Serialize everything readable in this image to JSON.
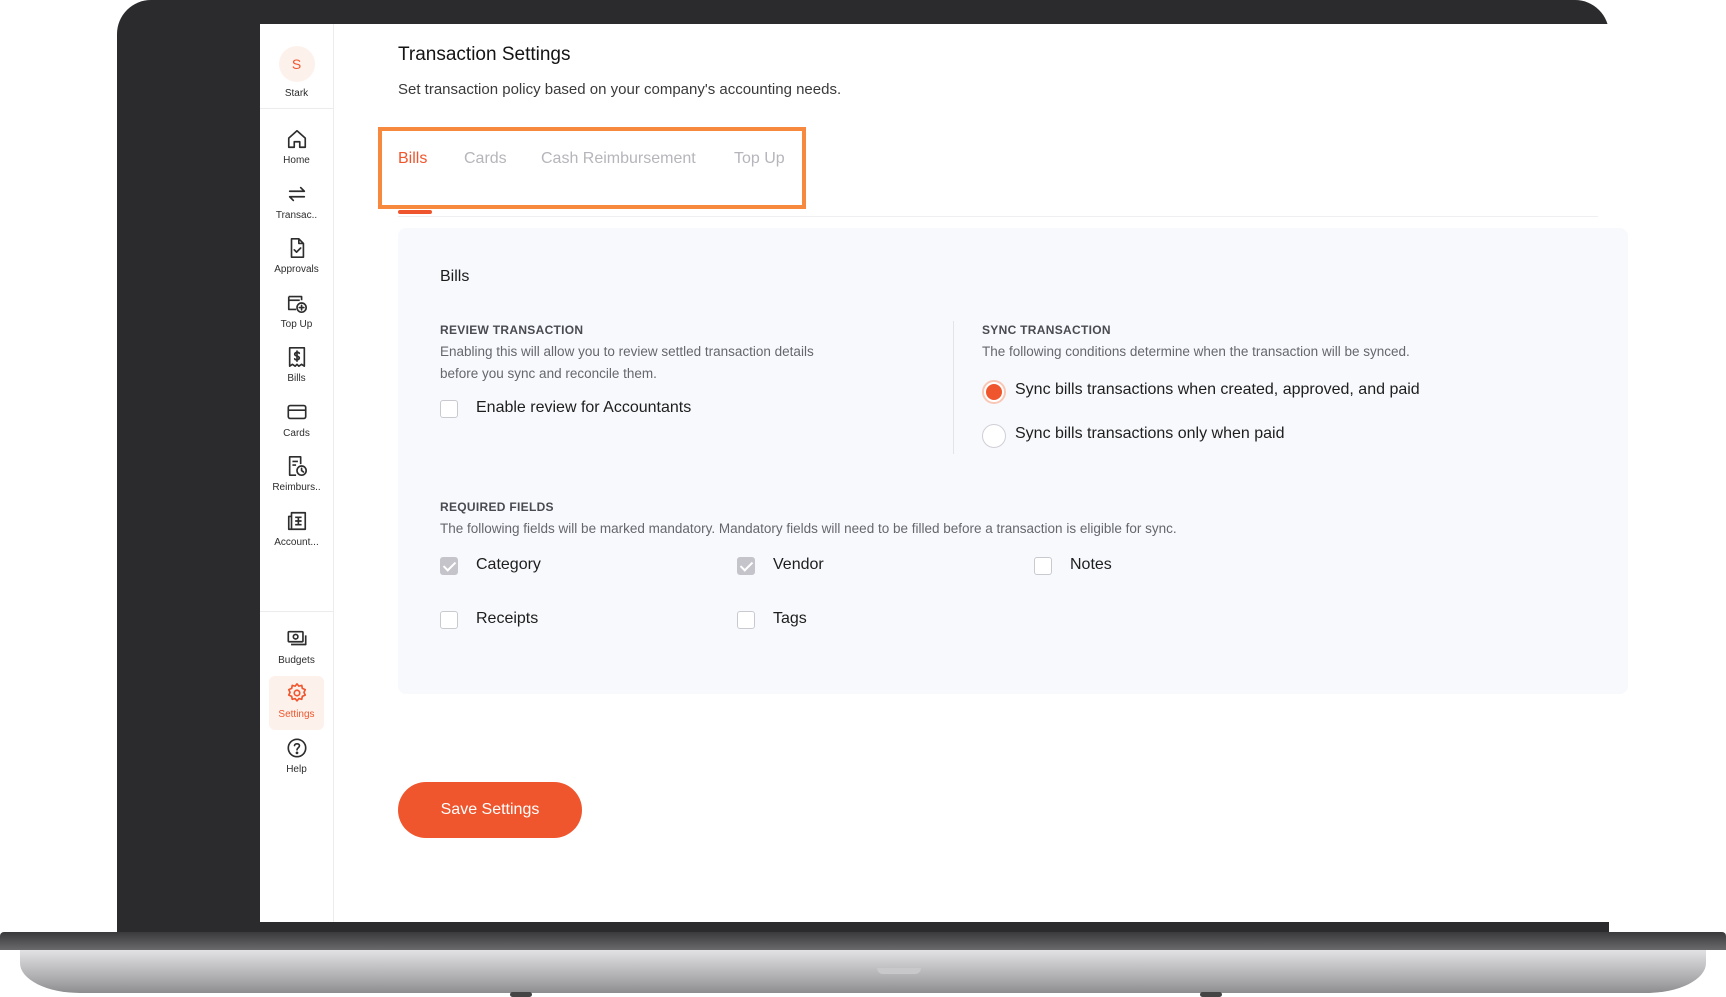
{
  "org": {
    "initial": "S",
    "name": "Stark"
  },
  "sidebar": {
    "items": [
      {
        "label": "Home",
        "icon": "home-icon"
      },
      {
        "label": "Transac..",
        "icon": "transfer-icon"
      },
      {
        "label": "Approvals",
        "icon": "document-check-icon"
      },
      {
        "label": "Top Up",
        "icon": "wallet-plus-icon"
      },
      {
        "label": "Bills",
        "icon": "bill-dollar-icon"
      },
      {
        "label": "Cards",
        "icon": "card-icon"
      },
      {
        "label": "Reimburs..",
        "icon": "receipt-clock-icon"
      },
      {
        "label": "Account...",
        "icon": "ledger-icon"
      }
    ],
    "bottom_items": [
      {
        "label": "Budgets",
        "icon": "money-icon"
      },
      {
        "label": "Settings",
        "icon": "gear-icon",
        "active": true
      },
      {
        "label": "Help",
        "icon": "help-icon"
      }
    ]
  },
  "page": {
    "title": "Transaction Settings",
    "subtitle": "Set transaction policy based on your company's accounting needs."
  },
  "tabs": [
    {
      "label": "Bills",
      "active": true
    },
    {
      "label": "Cards",
      "active": false
    },
    {
      "label": "Cash Reimbursement",
      "active": false
    },
    {
      "label": "Top Up",
      "active": false
    }
  ],
  "bills": {
    "title": "Bills",
    "review": {
      "heading": "REVIEW TRANSACTION",
      "description_line1": "Enabling this will allow you to review settled transaction details",
      "description_line2": "before you sync and reconcile them.",
      "checkbox_label": "Enable review for Accountants",
      "checked": false
    },
    "sync": {
      "heading": "SYNC TRANSACTION",
      "description": "The following conditions determine when the transaction will be synced.",
      "options": [
        {
          "label": "Sync bills transactions when created, approved, and paid",
          "selected": true
        },
        {
          "label": "Sync bills transactions only when paid",
          "selected": false
        }
      ]
    },
    "required_fields": {
      "heading": "REQUIRED FIELDS",
      "description": "The following fields will be marked mandatory. Mandatory fields will need to be filled before a transaction is eligible for sync.",
      "fields": [
        {
          "label": "Category",
          "checked": true
        },
        {
          "label": "Vendor",
          "checked": true
        },
        {
          "label": "Notes",
          "checked": false
        },
        {
          "label": "Receipts",
          "checked": false
        },
        {
          "label": "Tags",
          "checked": false
        }
      ]
    }
  },
  "actions": {
    "save_label": "Save Settings"
  },
  "colors": {
    "accent": "#f0562d",
    "highlight_border": "#f6893e",
    "card_bg": "#f8f9fc"
  }
}
